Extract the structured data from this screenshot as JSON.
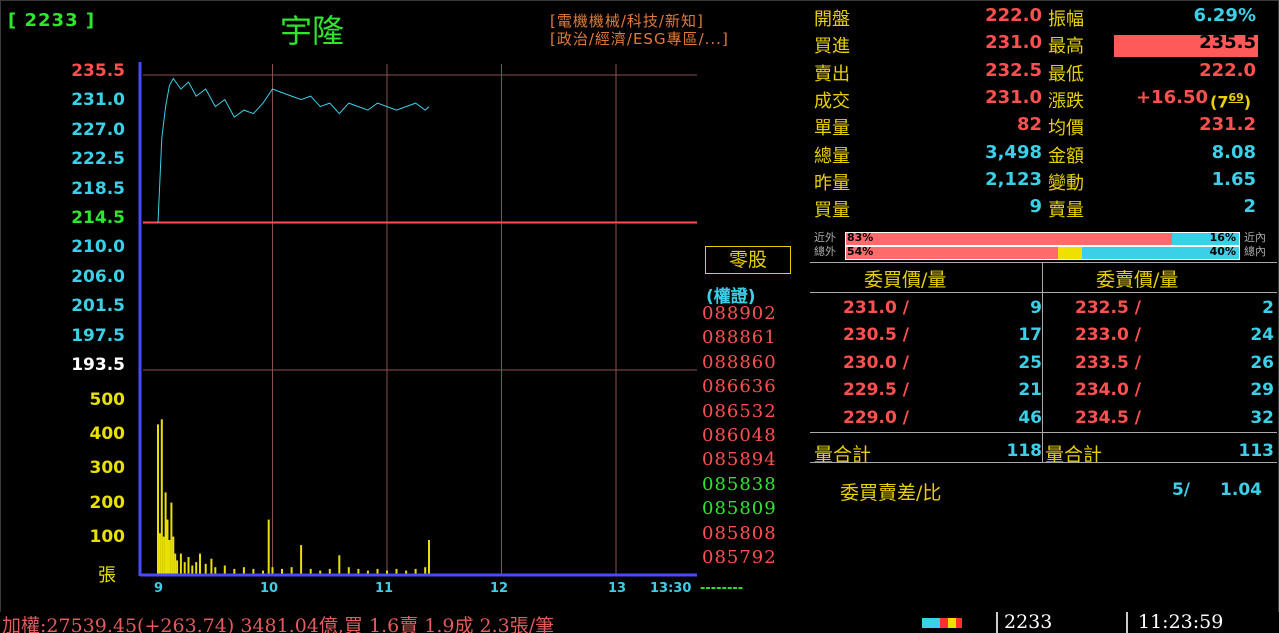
{
  "header": {
    "code_label": "[ 2233 ]",
    "stock_name": "宇隆",
    "categories_1": "[電機機械/科技/新知]",
    "categories_2": "[政治/經濟/ESG專區/...]"
  },
  "colors": {
    "green": "#2ee62e",
    "red": "#ff5050",
    "cyan": "#3ad0e8",
    "yellow": "#e8e000",
    "chart_axis": "#4a4aff",
    "grid": "#8a5050"
  },
  "price_axis": {
    "labels": [
      {
        "text": "235.5",
        "color": "#ff5050"
      },
      {
        "text": "231.0",
        "color": "#3ad0e8"
      },
      {
        "text": "227.0",
        "color": "#3ad0e8"
      },
      {
        "text": "222.5",
        "color": "#3ad0e8"
      },
      {
        "text": "218.5",
        "color": "#3ad0e8"
      },
      {
        "text": "214.5",
        "color": "#2ee62e"
      },
      {
        "text": "210.0",
        "color": "#3ad0e8"
      },
      {
        "text": "206.0",
        "color": "#3ad0e8"
      },
      {
        "text": "201.5",
        "color": "#3ad0e8"
      },
      {
        "text": "197.5",
        "color": "#3ad0e8"
      },
      {
        "text": "193.5",
        "color": "#ffffff"
      }
    ]
  },
  "volume_axis": {
    "labels": [
      "500",
      "400",
      "300",
      "200",
      "100"
    ],
    "unit": "張"
  },
  "time_axis": {
    "labels": [
      "9",
      "10",
      "11",
      "12",
      "13",
      "13:30"
    ],
    "trailing": "--------"
  },
  "odd_lot_button": "零股",
  "warrants": {
    "title": "(權證)",
    "items": [
      {
        "code": "088902",
        "color": "#ff5050"
      },
      {
        "code": "088861",
        "color": "#ff5050"
      },
      {
        "code": "088860",
        "color": "#ff5050"
      },
      {
        "code": "086636",
        "color": "#ff5050"
      },
      {
        "code": "086532",
        "color": "#ff5050"
      },
      {
        "code": "086048",
        "color": "#ff5050"
      },
      {
        "code": "085894",
        "color": "#ff5050"
      },
      {
        "code": "085838",
        "color": "#2ee62e"
      },
      {
        "code": "085809",
        "color": "#2ee62e"
      },
      {
        "code": "085808",
        "color": "#ff5050"
      },
      {
        "code": "085792",
        "color": "#ff5050"
      }
    ]
  },
  "quote": {
    "rows": [
      {
        "l1": "開盤",
        "v1": "222.0",
        "c1": "#ff5050",
        "l2": "振幅",
        "v2": "6.29%",
        "c2": "#3ad0e8"
      },
      {
        "l1": "買進",
        "v1": "231.0",
        "c1": "#ff5050",
        "l2": "最高",
        "v2": "235.5",
        "c2": "#000000"
      },
      {
        "l1": "賣出",
        "v1": "232.5",
        "c1": "#ff5050",
        "l2": "最低",
        "v2": "222.0",
        "c2": "#ff5050"
      },
      {
        "l1": "成交",
        "v1": "231.0",
        "c1": "#ff5050",
        "l2": "漲跌",
        "v2": "+16.50",
        "c2": "#ff5050"
      },
      {
        "l1": "單量",
        "v1": "82",
        "c1": "#ff5050",
        "l2": "均價",
        "v2": "231.2",
        "c2": "#ff5050"
      },
      {
        "l1": "總量",
        "v1": "3,498",
        "c1": "#3ad0e8",
        "l2": "金額",
        "v2": "8.08",
        "c2": "#3ad0e8"
      },
      {
        "l1": "昨量",
        "v1": "2,123",
        "c1": "#3ad0e8",
        "l2": "變動",
        "v2": "1.65",
        "c2": "#3ad0e8"
      },
      {
        "l1": "買量",
        "v1": "9",
        "c1": "#3ad0e8",
        "l2": "賣量",
        "v2": "2",
        "c2": "#3ad0e8"
      }
    ],
    "change_rank_main": "7",
    "change_rank_frac": "69",
    "high_highlight": "#ff5a5a"
  },
  "ratio": {
    "near": {
      "left_label": "近外",
      "right_label": "近內",
      "left_pct": "83%",
      "right_pct": "16%",
      "left_value": 0.83
    },
    "total": {
      "left_label": "總外",
      "right_label": "總內",
      "left_pct": "54%",
      "right_pct": "40%",
      "left_value": 0.54,
      "neutral_value": 0.06
    }
  },
  "order_book": {
    "bid_header": "委買價/量",
    "ask_header": "委賣價/量",
    "bids": [
      {
        "price": "231.0",
        "qty": "9"
      },
      {
        "price": "230.5",
        "qty": "17"
      },
      {
        "price": "230.0",
        "qty": "25"
      },
      {
        "price": "229.5",
        "qty": "21"
      },
      {
        "price": "229.0",
        "qty": "46"
      }
    ],
    "asks": [
      {
        "price": "232.5",
        "qty": "2"
      },
      {
        "price": "233.0",
        "qty": "24"
      },
      {
        "price": "233.5",
        "qty": "26"
      },
      {
        "price": "234.0",
        "qty": "29"
      },
      {
        "price": "234.5",
        "qty": "32"
      }
    ],
    "bid_total_label": "量合計",
    "bid_total": "118",
    "ask_total_label": "量合計",
    "ask_total": "113",
    "diff_label": "委買賣差/比",
    "diff_value": "5/",
    "diff_ratio": "1.04"
  },
  "status_bar": {
    "ticker": "加權:27539.45(+263.74) 3481.04億,買 1.6賣 1.9成 2.3張/筆",
    "code": "2233",
    "time": "11:23:59"
  },
  "chart_data": [
    {
      "type": "line",
      "ylabel": "",
      "ylim": [
        193.5,
        235.5
      ],
      "x": [
        900,
        902,
        904,
        906,
        908,
        912,
        916,
        920,
        925,
        930,
        935,
        940,
        945,
        950,
        955,
        1000,
        1005,
        1010,
        1015,
        1020,
        1025,
        1030,
        1035,
        1040,
        1045,
        1050,
        1055,
        1100,
        1105,
        1110,
        1115,
        1120,
        1122
      ],
      "values": [
        214.5,
        226.5,
        231.0,
        234.0,
        235.0,
        233.5,
        234.5,
        232.5,
        233.5,
        231.0,
        232.0,
        229.5,
        230.5,
        230.0,
        231.5,
        233.5,
        233.0,
        232.5,
        232.0,
        232.5,
        231.0,
        231.5,
        230.0,
        231.5,
        231.0,
        230.5,
        231.5,
        231.0,
        230.5,
        231.0,
        231.5,
        230.5,
        231.0
      ]
    },
    {
      "type": "bar",
      "ylabel": "張",
      "ylim": [
        0,
        500
      ],
      "x": [
        900,
        901,
        902,
        903,
        904,
        905,
        906,
        907,
        908,
        909,
        910,
        912,
        914,
        916,
        918,
        920,
        922,
        925,
        928,
        930,
        935,
        940,
        945,
        950,
        955,
        958,
        1000,
        1005,
        1010,
        1015,
        1020,
        1025,
        1030,
        1035,
        1040,
        1045,
        1050,
        1055,
        1100,
        1105,
        1110,
        1115,
        1120,
        1122
      ],
      "values": [
        440,
        120,
        455,
        110,
        240,
        160,
        100,
        210,
        110,
        60,
        40,
        60,
        35,
        50,
        25,
        35,
        60,
        30,
        45,
        20,
        25,
        15,
        20,
        15,
        10,
        160,
        20,
        15,
        20,
        85,
        15,
        10,
        15,
        55,
        20,
        15,
        10,
        15,
        10,
        15,
        10,
        15,
        20,
        100
      ]
    }
  ]
}
